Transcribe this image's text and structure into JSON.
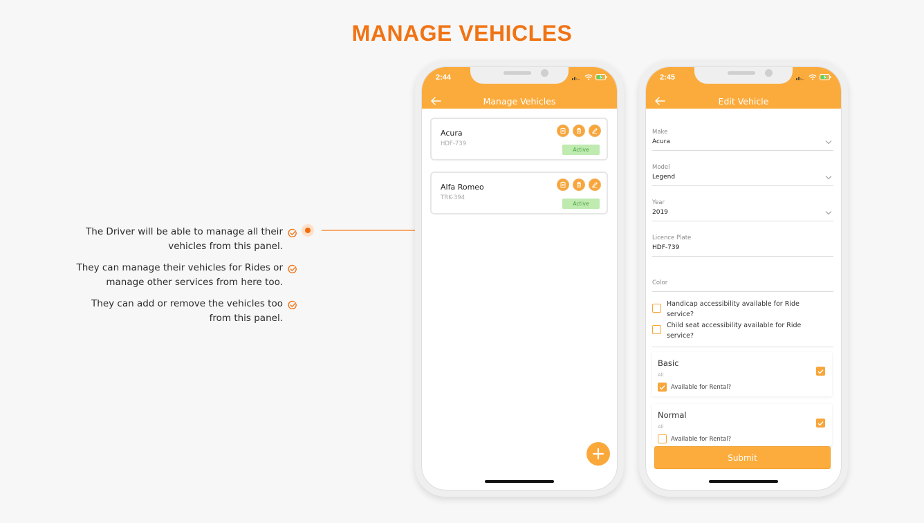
{
  "page": {
    "title": "MANAGE VEHICLES",
    "accent_color": "#f07314",
    "app_color": "#fbab3c"
  },
  "features": [
    {
      "text": "The Driver will be able to manage all their vehicles from this panel.",
      "icon": "check-circle-icon"
    },
    {
      "text": "They can manage their vehicles for Rides or manage other services from here too.",
      "icon": "check-circle-icon"
    },
    {
      "text": "They can add or remove the vehicles too from this panel.",
      "icon": "check-circle-icon"
    }
  ],
  "manage_screen": {
    "status_time": "2:44",
    "title": "Manage Vehicles",
    "back_icon": "arrow-left-icon",
    "vehicles": [
      {
        "name": "Acura",
        "plate": "HDF-739",
        "status": "Active",
        "actions": [
          "documents-icon",
          "trash-icon",
          "edit-icon"
        ]
      },
      {
        "name": "Alfa Romeo",
        "plate": "TRK-394",
        "status": "Active",
        "actions": [
          "documents-icon",
          "trash-icon",
          "edit-icon"
        ]
      }
    ],
    "fab_icon": "plus-icon"
  },
  "edit_screen": {
    "status_time": "2:45",
    "title": "Edit Vehicle",
    "back_icon": "arrow-left-icon",
    "fields": {
      "make": {
        "label": "Make",
        "value": "Acura"
      },
      "model": {
        "label": "Model",
        "value": "Legend"
      },
      "year": {
        "label": "Year",
        "value": "2019"
      },
      "plate": {
        "label": "Licence Plate",
        "value": "HDF-739"
      },
      "color": {
        "label": "Color",
        "value": ""
      }
    },
    "accessibility": [
      {
        "label": "Handicap accessibility available for Ride service?",
        "checked": false
      },
      {
        "label": "Child seat accessibility available for Ride service?",
        "checked": false
      }
    ],
    "services": [
      {
        "name": "Basic",
        "sub": "All",
        "enabled": true,
        "rental_label": "Available for Rental?",
        "rental": true
      },
      {
        "name": "Normal",
        "sub": "All",
        "enabled": true,
        "rental_label": "Available for Rental?",
        "rental": false
      }
    ],
    "submit_label": "Submit"
  }
}
